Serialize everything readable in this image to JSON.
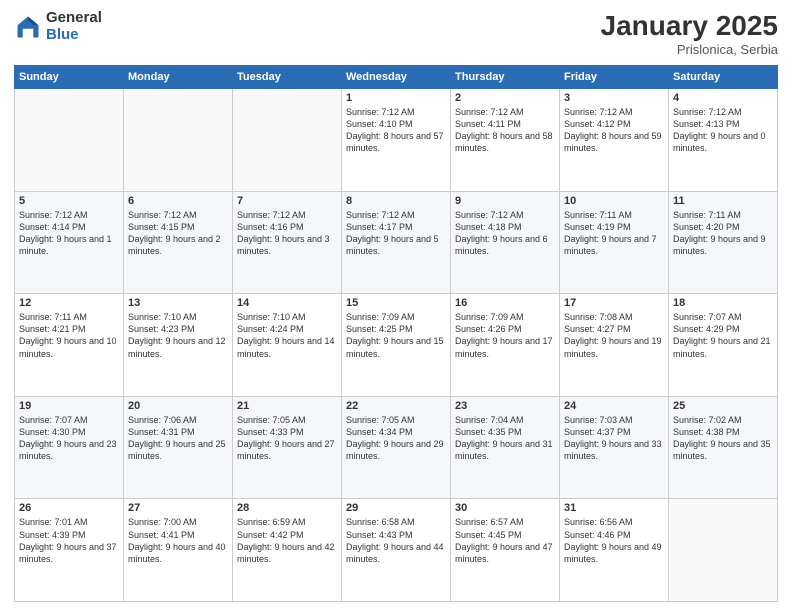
{
  "logo": {
    "general": "General",
    "blue": "Blue"
  },
  "header": {
    "month": "January 2025",
    "location": "Prislonica, Serbia"
  },
  "days_of_week": [
    "Sunday",
    "Monday",
    "Tuesday",
    "Wednesday",
    "Thursday",
    "Friday",
    "Saturday"
  ],
  "weeks": [
    [
      {
        "num": "",
        "info": ""
      },
      {
        "num": "",
        "info": ""
      },
      {
        "num": "",
        "info": ""
      },
      {
        "num": "1",
        "info": "Sunrise: 7:12 AM\nSunset: 4:10 PM\nDaylight: 8 hours and 57 minutes."
      },
      {
        "num": "2",
        "info": "Sunrise: 7:12 AM\nSunset: 4:11 PM\nDaylight: 8 hours and 58 minutes."
      },
      {
        "num": "3",
        "info": "Sunrise: 7:12 AM\nSunset: 4:12 PM\nDaylight: 8 hours and 59 minutes."
      },
      {
        "num": "4",
        "info": "Sunrise: 7:12 AM\nSunset: 4:13 PM\nDaylight: 9 hours and 0 minutes."
      }
    ],
    [
      {
        "num": "5",
        "info": "Sunrise: 7:12 AM\nSunset: 4:14 PM\nDaylight: 9 hours and 1 minute."
      },
      {
        "num": "6",
        "info": "Sunrise: 7:12 AM\nSunset: 4:15 PM\nDaylight: 9 hours and 2 minutes."
      },
      {
        "num": "7",
        "info": "Sunrise: 7:12 AM\nSunset: 4:16 PM\nDaylight: 9 hours and 3 minutes."
      },
      {
        "num": "8",
        "info": "Sunrise: 7:12 AM\nSunset: 4:17 PM\nDaylight: 9 hours and 5 minutes."
      },
      {
        "num": "9",
        "info": "Sunrise: 7:12 AM\nSunset: 4:18 PM\nDaylight: 9 hours and 6 minutes."
      },
      {
        "num": "10",
        "info": "Sunrise: 7:11 AM\nSunset: 4:19 PM\nDaylight: 9 hours and 7 minutes."
      },
      {
        "num": "11",
        "info": "Sunrise: 7:11 AM\nSunset: 4:20 PM\nDaylight: 9 hours and 9 minutes."
      }
    ],
    [
      {
        "num": "12",
        "info": "Sunrise: 7:11 AM\nSunset: 4:21 PM\nDaylight: 9 hours and 10 minutes."
      },
      {
        "num": "13",
        "info": "Sunrise: 7:10 AM\nSunset: 4:23 PM\nDaylight: 9 hours and 12 minutes."
      },
      {
        "num": "14",
        "info": "Sunrise: 7:10 AM\nSunset: 4:24 PM\nDaylight: 9 hours and 14 minutes."
      },
      {
        "num": "15",
        "info": "Sunrise: 7:09 AM\nSunset: 4:25 PM\nDaylight: 9 hours and 15 minutes."
      },
      {
        "num": "16",
        "info": "Sunrise: 7:09 AM\nSunset: 4:26 PM\nDaylight: 9 hours and 17 minutes."
      },
      {
        "num": "17",
        "info": "Sunrise: 7:08 AM\nSunset: 4:27 PM\nDaylight: 9 hours and 19 minutes."
      },
      {
        "num": "18",
        "info": "Sunrise: 7:07 AM\nSunset: 4:29 PM\nDaylight: 9 hours and 21 minutes."
      }
    ],
    [
      {
        "num": "19",
        "info": "Sunrise: 7:07 AM\nSunset: 4:30 PM\nDaylight: 9 hours and 23 minutes."
      },
      {
        "num": "20",
        "info": "Sunrise: 7:06 AM\nSunset: 4:31 PM\nDaylight: 9 hours and 25 minutes."
      },
      {
        "num": "21",
        "info": "Sunrise: 7:05 AM\nSunset: 4:33 PM\nDaylight: 9 hours and 27 minutes."
      },
      {
        "num": "22",
        "info": "Sunrise: 7:05 AM\nSunset: 4:34 PM\nDaylight: 9 hours and 29 minutes."
      },
      {
        "num": "23",
        "info": "Sunrise: 7:04 AM\nSunset: 4:35 PM\nDaylight: 9 hours and 31 minutes."
      },
      {
        "num": "24",
        "info": "Sunrise: 7:03 AM\nSunset: 4:37 PM\nDaylight: 9 hours and 33 minutes."
      },
      {
        "num": "25",
        "info": "Sunrise: 7:02 AM\nSunset: 4:38 PM\nDaylight: 9 hours and 35 minutes."
      }
    ],
    [
      {
        "num": "26",
        "info": "Sunrise: 7:01 AM\nSunset: 4:39 PM\nDaylight: 9 hours and 37 minutes."
      },
      {
        "num": "27",
        "info": "Sunrise: 7:00 AM\nSunset: 4:41 PM\nDaylight: 9 hours and 40 minutes."
      },
      {
        "num": "28",
        "info": "Sunrise: 6:59 AM\nSunset: 4:42 PM\nDaylight: 9 hours and 42 minutes."
      },
      {
        "num": "29",
        "info": "Sunrise: 6:58 AM\nSunset: 4:43 PM\nDaylight: 9 hours and 44 minutes."
      },
      {
        "num": "30",
        "info": "Sunrise: 6:57 AM\nSunset: 4:45 PM\nDaylight: 9 hours and 47 minutes."
      },
      {
        "num": "31",
        "info": "Sunrise: 6:56 AM\nSunset: 4:46 PM\nDaylight: 9 hours and 49 minutes."
      },
      {
        "num": "",
        "info": ""
      }
    ]
  ]
}
